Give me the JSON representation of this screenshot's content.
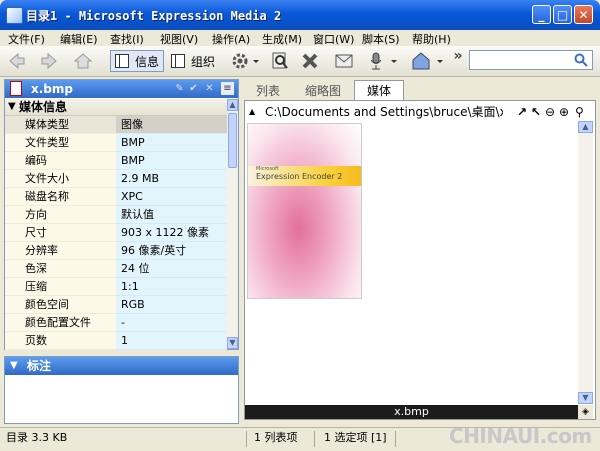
{
  "window": {
    "title": "目录1 - Microsoft Expression Media 2",
    "controls": [
      "_",
      "□",
      "✕"
    ]
  },
  "menu": [
    "文件(F)",
    "编辑(E)",
    "查找(I)",
    "视图(V)",
    "操作(A)",
    "生成(M)",
    "窗口(W)",
    "脚本(S)",
    "帮助(H)"
  ],
  "toolbar": {
    "info_label": "信息",
    "organize_label": "组织",
    "overflow": "»"
  },
  "info_panel": {
    "file_name": "x.bmp",
    "section_title": "媒体信息",
    "rows": [
      {
        "key": "媒体类型",
        "value": "图像"
      },
      {
        "key": "文件类型",
        "value": "BMP"
      },
      {
        "key": "编码",
        "value": "BMP"
      },
      {
        "key": "文件大小",
        "value": "2.9 MB"
      },
      {
        "key": "磁盘名称",
        "value": "XPC"
      },
      {
        "key": "方向",
        "value": "默认值"
      },
      {
        "key": "尺寸",
        "value": "903 x 1122 像素"
      },
      {
        "key": "分辨率",
        "value": "96 像素/英寸"
      },
      {
        "key": "色深",
        "value": "24 位"
      },
      {
        "key": "压缩",
        "value": "1:1"
      },
      {
        "key": "颜色空间",
        "value": "RGB"
      },
      {
        "key": "颜色配置文件",
        "value": "-"
      },
      {
        "key": "页数",
        "value": "1"
      }
    ]
  },
  "notes_panel": {
    "title": "标注"
  },
  "tabs": [
    "列表",
    "缩略图",
    "媒体"
  ],
  "viewer": {
    "path": "C:\\Documents and Settings\\bruce\\桌面\\x.bmp",
    "thumb_brand_small": "Microsoft",
    "thumb_brand": "Expression Encoder 2",
    "filename_label": "x.bmp"
  },
  "status": {
    "catalog": "目录  3.3 KB",
    "list_items": "1 列表项",
    "selected": "1 选定项 [1]"
  },
  "watermark": "CHINAUI.com"
}
